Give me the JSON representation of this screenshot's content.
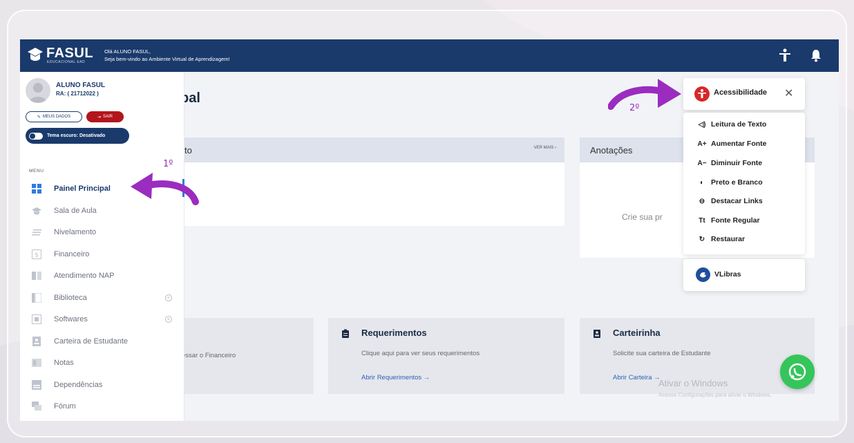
{
  "header": {
    "logo_text": "FASUL",
    "logo_sub": "EDUCACIONAL EAD",
    "greeting_line1": "Olá ALUNO FASUL,",
    "greeting_line2": "Seja bem-vindo ao Ambiente Virtual de Aprendizagem!",
    "icons": [
      "accessibility-person-icon",
      "bell-icon"
    ]
  },
  "profile": {
    "name": "ALUNO FASUL",
    "ra": "RA: ( 21712022 )",
    "meus_dados": "MEUS DADOS",
    "sair": "SAIR",
    "dark_theme": "Tema escuro: Desativado"
  },
  "menu": {
    "title": "MENU",
    "items": [
      {
        "label": "Painel Principal",
        "active": true
      },
      {
        "label": "Sala de Aula"
      },
      {
        "label": "Nivelamento"
      },
      {
        "label": "Financeiro"
      },
      {
        "label": "Atendimento NAP"
      },
      {
        "label": "Biblioteca",
        "expandable": true
      },
      {
        "label": "Softwares",
        "expandable": true
      },
      {
        "label": "Carteira de Estudante"
      },
      {
        "label": "Notas"
      },
      {
        "label": "Dependências"
      },
      {
        "label": "Fórum"
      }
    ]
  },
  "main": {
    "title_partial": "pal",
    "card1_head_partial": "to",
    "ver_mais": "VER MAIS",
    "notes_title": "Anotações",
    "notes_text_partial": "Crie sua pr",
    "financeiro_partial": "essar o Financeiro",
    "requerimentos": {
      "title": "Requerimentos",
      "desc": "Clique aqui para ver seus requerimentos",
      "link": "Abrir Requerimentos →"
    },
    "carteirinha": {
      "title": "Carteirinha",
      "desc": "Solicite sua carteira de Estudante",
      "link": "Abrir Carteira →"
    }
  },
  "accessibility": {
    "title": "Acessibilidade",
    "items": [
      {
        "icon": "speaker-icon",
        "glyph": "◁)",
        "label": "Leitura de Texto"
      },
      {
        "icon": "increase-font-icon",
        "glyph": "A+",
        "label": "Aumentar Fonte"
      },
      {
        "icon": "decrease-font-icon",
        "glyph": "A−",
        "label": "Diminuir Fonte"
      },
      {
        "icon": "contrast-icon",
        "glyph": "◐",
        "label": "Preto e Branco"
      },
      {
        "icon": "link-icon",
        "glyph": "⊖",
        "label": "Destacar Links"
      },
      {
        "icon": "font-regular-icon",
        "glyph": "Tt",
        "label": "Fonte Regular"
      },
      {
        "icon": "restore-icon",
        "glyph": "↻",
        "label": "Restaurar"
      }
    ],
    "vlibras": "VLibras"
  },
  "annotations": {
    "step1": "1º",
    "step2": "2º",
    "arrow_color": "#9b2cc0"
  },
  "watermark": {
    "line1": "Ativar o Windows",
    "line2": "Acesse Configurações para ativar o Windows."
  },
  "colors": {
    "navy": "#1a3a6b",
    "red": "#b3151d",
    "whatsapp": "#35c55a"
  }
}
